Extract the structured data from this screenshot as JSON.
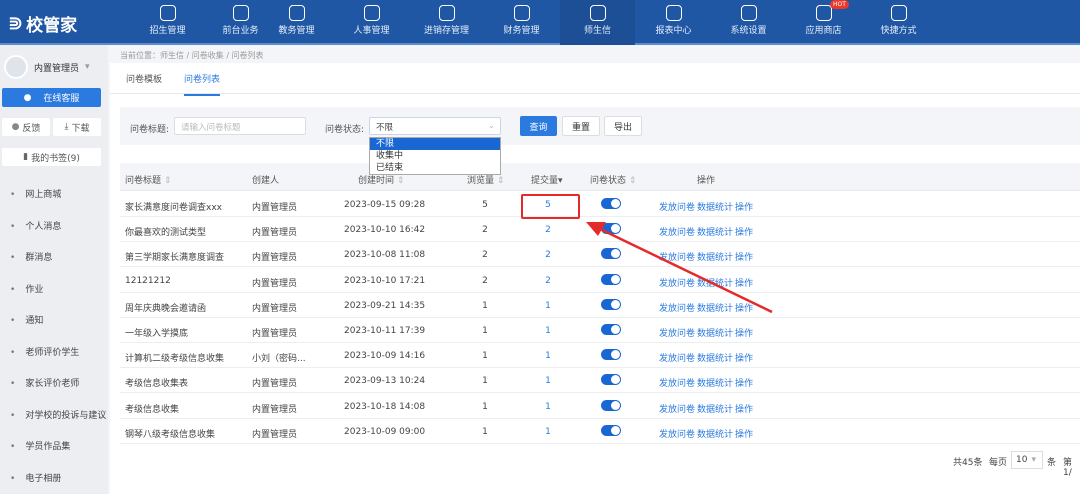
{
  "app": {
    "logo": "校管家"
  },
  "nav": [
    {
      "label": "招生管理",
      "icon": "user-plus-icon"
    },
    {
      "label": "前台业务",
      "icon": "monitor-icon"
    },
    {
      "label": "教务管理",
      "icon": "book-icon"
    },
    {
      "label": "人事管理",
      "icon": "person-icon"
    },
    {
      "label": "进销存管理",
      "icon": "inventory-icon"
    },
    {
      "label": "财务管理",
      "icon": "finance-icon"
    },
    {
      "label": "师生信",
      "icon": "chat-icon",
      "active": true
    },
    {
      "label": "报表中心",
      "icon": "chart-icon"
    },
    {
      "label": "系统设置",
      "icon": "gear-icon"
    },
    {
      "label": "应用商店",
      "icon": "apps-icon",
      "badge": "HOT"
    },
    {
      "label": "快捷方式",
      "icon": "link-icon"
    }
  ],
  "sidebar": {
    "user": "内置管理员",
    "online_service": "在线客服",
    "feedback": "反馈",
    "download": "下载",
    "bookmarks": "我的书签(9)",
    "items": [
      "网上商城",
      "个人消息",
      "群消息",
      "作业",
      "通知",
      "老师评价学生",
      "家长评价老师",
      "对学校的投诉与建议",
      "学员作品集",
      "电子相册"
    ]
  },
  "breadcrumb": "当前位置：师生信 / 问卷收集 / 问卷列表",
  "tabs": [
    {
      "label": "问卷模板"
    },
    {
      "label": "问卷列表",
      "active": true
    }
  ],
  "filter": {
    "title_label": "问卷标题:",
    "title_placeholder": "请输入问卷标题",
    "status_label": "问卷状态:",
    "status_value": "不限",
    "status_options": [
      "不限",
      "收集中",
      "已结束"
    ],
    "query": "查询",
    "reset": "重置",
    "export": "导出"
  },
  "table": {
    "headers": [
      "问卷标题",
      "创建人",
      "创建时间",
      "浏览量",
      "提交量",
      "问卷状态",
      "操作"
    ],
    "actions": [
      "发放问卷",
      "数据统计",
      "操作"
    ],
    "rows": [
      {
        "title": "家长满意度问卷调查xxx",
        "creator": "内置管理员",
        "created": "2023-09-15 09:28",
        "views": "5",
        "submits": "5",
        "enabled": true
      },
      {
        "title": "你最喜欢的测试类型",
        "creator": "内置管理员",
        "created": "2023-10-10 16:42",
        "views": "2",
        "submits": "2",
        "enabled": true
      },
      {
        "title": "第三学期家长满意度调查",
        "creator": "内置管理员",
        "created": "2023-10-08 11:08",
        "views": "2",
        "submits": "2",
        "enabled": true
      },
      {
        "title": "12121212",
        "creator": "内置管理员",
        "created": "2023-10-10 17:21",
        "views": "2",
        "submits": "2",
        "enabled": true
      },
      {
        "title": "周年庆典晚会邀请函",
        "creator": "内置管理员",
        "created": "2023-09-21 14:35",
        "views": "1",
        "submits": "1",
        "enabled": true
      },
      {
        "title": "一年级入学摸底",
        "creator": "内置管理员",
        "created": "2023-10-11 17:39",
        "views": "1",
        "submits": "1",
        "enabled": true
      },
      {
        "title": "计算机二级考级信息收集",
        "creator": "小刘（密码...",
        "created": "2023-10-09 14:16",
        "views": "1",
        "submits": "1",
        "enabled": true
      },
      {
        "title": "考级信息收集表",
        "creator": "内置管理员",
        "created": "2023-09-13 10:24",
        "views": "1",
        "submits": "1",
        "enabled": true
      },
      {
        "title": "考级信息收集",
        "creator": "内置管理员",
        "created": "2023-10-18 14:08",
        "views": "1",
        "submits": "1",
        "enabled": true
      },
      {
        "title": "钢琴八级考级信息收集",
        "creator": "内置管理员",
        "created": "2023-10-09 09:00",
        "views": "1",
        "submits": "1",
        "enabled": true
      }
    ]
  },
  "pagination": {
    "total": "共45条",
    "per_page_label": "每页",
    "per_page": "10",
    "unit": "条",
    "page": "第1/"
  },
  "colors": {
    "topbar": "#1f57a5",
    "accent": "#2b7ae0",
    "highlight": "#e52a2a"
  }
}
